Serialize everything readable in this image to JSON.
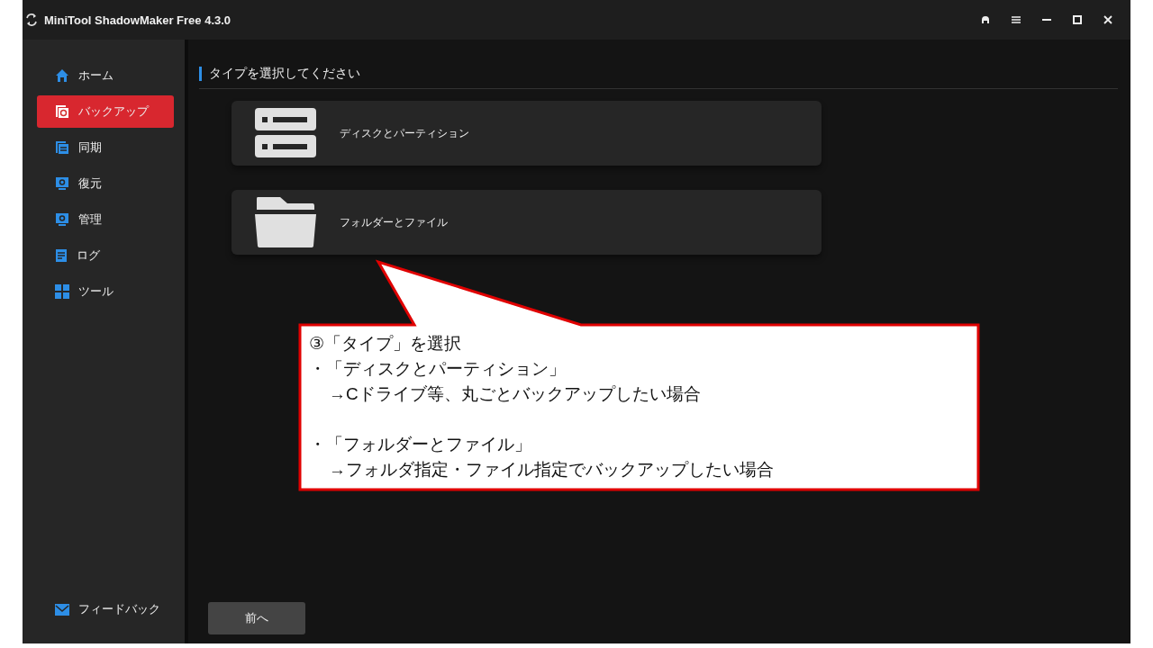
{
  "window": {
    "title": "MiniTool ShadowMaker Free 4.3.0"
  },
  "sidebar": {
    "items": [
      {
        "label": "ホーム",
        "selected": false
      },
      {
        "label": "バックアップ",
        "selected": true
      },
      {
        "label": "同期",
        "selected": false
      },
      {
        "label": "復元",
        "selected": false
      },
      {
        "label": "管理",
        "selected": false
      },
      {
        "label": "ログ",
        "selected": false
      },
      {
        "label": "ツール",
        "selected": false
      }
    ],
    "footer": {
      "label": "フィードバック"
    }
  },
  "main": {
    "heading": "タイプを選択してください",
    "options": [
      {
        "label": "ディスクとパーティション"
      },
      {
        "label": "フォルダーとファイル"
      }
    ],
    "back_button": "前へ"
  },
  "callout": {
    "title": "③「タイプ」を選択",
    "groups": [
      {
        "bullet": "・「ディスクとパーティション」",
        "detail": "→Cドライブ等、丸ごとバックアップしたい場合"
      },
      {
        "bullet": "・「フォルダーとファイル」",
        "detail": "→フォルダ指定・ファイル指定でバックアップしたい場合"
      }
    ]
  }
}
